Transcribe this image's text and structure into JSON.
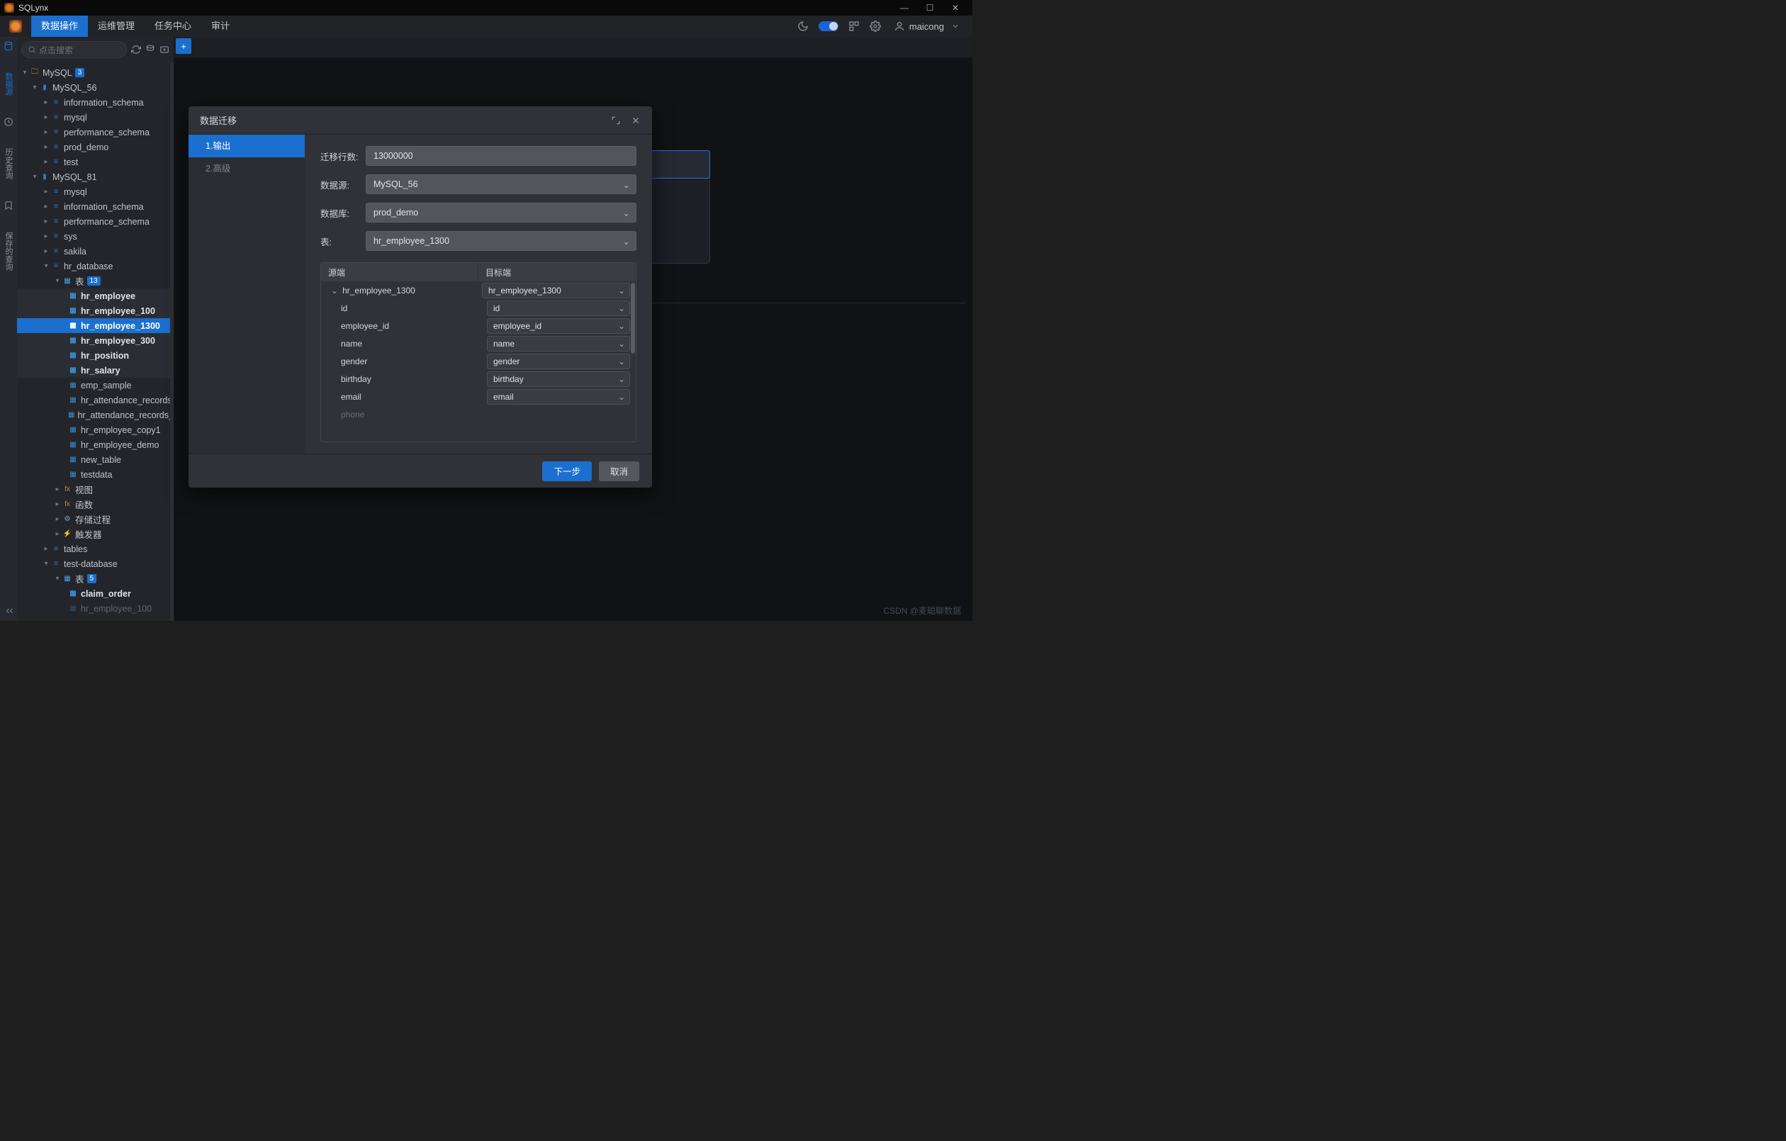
{
  "titlebar": {
    "app": "SQLynx"
  },
  "topnav": {
    "tabs": [
      "数据操作",
      "运维管理",
      "任务中心",
      "审计"
    ],
    "active": 0,
    "username": "maicong"
  },
  "rail": {
    "items": [
      "数据源",
      "历史查询",
      "保存的查询"
    ],
    "active": 0
  },
  "sidebar": {
    "search_placeholder": "点击搜索"
  },
  "tree": {
    "root": {
      "label": "MySQL",
      "badge": "3"
    },
    "conn56": "MySQL_56",
    "dbs56": [
      "information_schema",
      "mysql",
      "performance_schema",
      "prod_demo",
      "test"
    ],
    "conn81": "MySQL_81",
    "dbs81": [
      "mysql",
      "information_schema",
      "performance_schema",
      "sys",
      "sakila",
      "hr_database"
    ],
    "tables_label": "表",
    "tables_badge": "13",
    "tables_bold": [
      "hr_employee",
      "hr_employee_100",
      "hr_employee_1300",
      "hr_employee_300",
      "hr_position",
      "hr_salary"
    ],
    "tables_rest": [
      "emp_sample",
      "hr_attendance_records",
      "hr_attendance_records_s",
      "hr_employee_copy1",
      "hr_employee_demo",
      "new_table",
      "testdata"
    ],
    "folders": [
      "视图",
      "函数",
      "存储过程",
      "触发器"
    ],
    "db_tables": "tables",
    "db_test": "test-database",
    "test_tables_badge": "5",
    "test_tables": [
      "claim_order",
      "hr_employee_100"
    ]
  },
  "dialog": {
    "title": "数据迁移",
    "steps": [
      "1.输出",
      "2.高级"
    ],
    "active_step": 0,
    "fields": {
      "rows_label": "迁移行数:",
      "rows_value": "13000000",
      "source_label": "数据源:",
      "source_value": "MySQL_56",
      "database_label": "数据库:",
      "database_value": "prod_demo",
      "table_label": "表:",
      "table_value": "hr_employee_1300"
    },
    "map": {
      "head_src": "源端",
      "head_tgt": "目标端",
      "root_src": "hr_employee_1300",
      "root_tgt": "hr_employee_1300",
      "cols": [
        {
          "src": "id",
          "tgt": "id"
        },
        {
          "src": "employee_id",
          "tgt": "employee_id"
        },
        {
          "src": "name",
          "tgt": "name"
        },
        {
          "src": "gender",
          "tgt": "gender"
        },
        {
          "src": "birthday",
          "tgt": "birthday"
        },
        {
          "src": "email",
          "tgt": "email"
        },
        {
          "src": "phone",
          "tgt": ""
        }
      ]
    },
    "next": "下一步",
    "cancel": "取消"
  },
  "watermark": "CSDN @麦聪聊数据"
}
